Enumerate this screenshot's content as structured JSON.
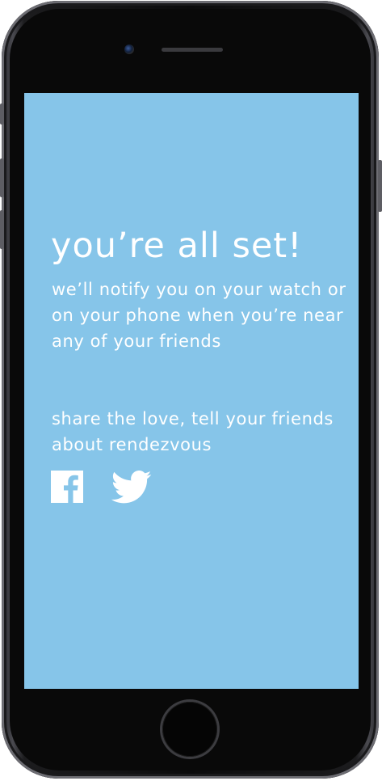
{
  "confirmation": {
    "title": "you’re all set!",
    "notify_text": "we’ll notify you on your watch or on your phone when you’re near any of your friends",
    "share_text": "share the love, tell your friends about rendezvous"
  },
  "social": {
    "facebook_icon": "facebook-icon",
    "twitter_icon": "twitter-icon"
  },
  "colors": {
    "screen_background": "#86c5e9",
    "text": "#ffffff",
    "device_body": "#0b0b0c"
  }
}
